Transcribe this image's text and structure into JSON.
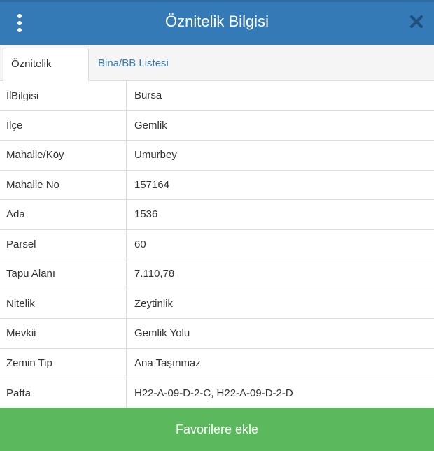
{
  "header": {
    "title": "Öznitelik Bilgisi",
    "menu_icon": "vertical-ellipsis-icon",
    "close_icon": "close-icon",
    "background": "#337ab7"
  },
  "tabs": [
    {
      "label": "Öznitelik Bilgisi",
      "active": true
    },
    {
      "label": "Bina/BB Listesi",
      "active": false
    }
  ],
  "attributes": [
    {
      "label": "İl",
      "value": "Bursa"
    },
    {
      "label": "İlçe",
      "value": "Gemlik"
    },
    {
      "label": "Mahalle/Köy",
      "value": "Umurbey"
    },
    {
      "label": "Mahalle No",
      "value": "157164"
    },
    {
      "label": "Ada",
      "value": "1536"
    },
    {
      "label": "Parsel",
      "value": "60"
    },
    {
      "label": "Tapu Alanı",
      "value": "7.110,78"
    },
    {
      "label": "Nitelik",
      "value": "Zeytinlik"
    },
    {
      "label": "Mevkii",
      "value": "Gemlik Yolu"
    },
    {
      "label": "Zemin Tip",
      "value": "Ana Taşınmaz"
    },
    {
      "label": "Pafta",
      "value": "H22-A-09-D-2-C, H22-A-09-D-2-D"
    }
  ],
  "footer": {
    "button_label": "Favorilere ekle",
    "background": "#5cb85c"
  }
}
